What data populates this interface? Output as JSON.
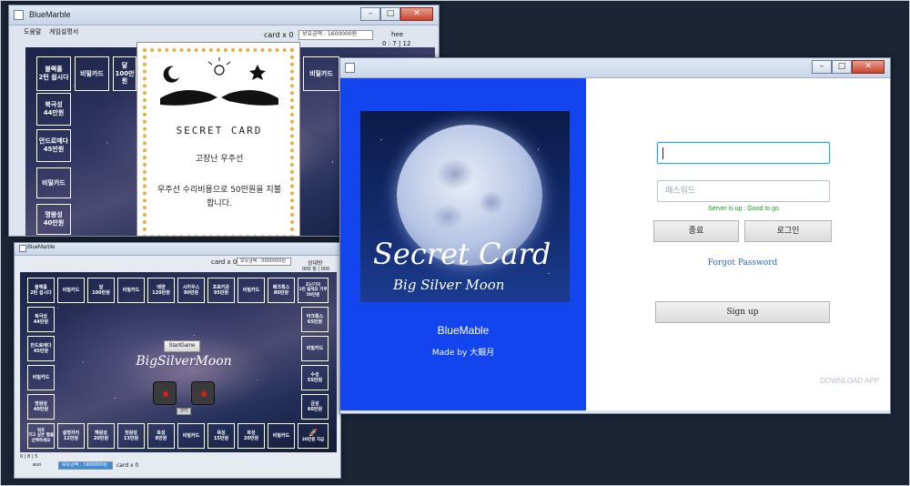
{
  "window_back": {
    "title": "BlueMarble",
    "menu": [
      "도움말",
      "게임설명서"
    ],
    "card_label": "card x 0",
    "money": "보유금액 : 1600000원",
    "user": "hee",
    "turn_info": "0 : 7 | 12",
    "cells": [
      {
        "name": "블랙홀",
        "sub": "2턴 쉽시다"
      },
      {
        "name": "비밀카드",
        "sub": ""
      },
      {
        "name": "달",
        "sub": "100만원"
      },
      {
        "name": "비밀카드",
        "sub": ""
      },
      {
        "name": "북극성",
        "sub": "44만원"
      },
      {
        "name": "안드로메다",
        "sub": "45만원"
      },
      {
        "name": "비밀카드",
        "sub": ""
      },
      {
        "name": "명왕성",
        "sub": "40만원"
      }
    ]
  },
  "secret_card": {
    "heading": "SECRET CARD",
    "subtitle": "고장난 우주선",
    "message": "우주선 수리비용으로 50만원을 지불합니다."
  },
  "window_game": {
    "title": "BlueMarble",
    "card_label": "card x 0",
    "money": "보유금액 : 0000000원",
    "opponent": "상대방",
    "opponent_info": "000 월 | 000",
    "start_button": "StartGame",
    "logo_text": "BigSilverMoon",
    "dice_labels": [
      "",
      ""
    ],
    "roll_label": "굴려",
    "bottom_info": "0 | 8 | 5",
    "bottom_user": "eun",
    "bottom_money": "보유금액 : 1600000원",
    "bottom_card": "card x 0",
    "top_row": [
      {
        "name": "블랙홀",
        "sub": "2턴 쉽시다"
      },
      {
        "name": "비밀카드",
        "sub": ""
      },
      {
        "name": "달",
        "sub": "100만원"
      },
      {
        "name": "비밀카드",
        "sub": ""
      },
      {
        "name": "태양",
        "sub": "120만원"
      },
      {
        "name": "시리우스",
        "sub": "90만원"
      },
      {
        "name": "프로키온",
        "sub": "95만원"
      },
      {
        "name": "비밀카드",
        "sub": ""
      },
      {
        "name": "베크룩스",
        "sub": "80만원"
      },
      {
        "name": "조난기지",
        "sub": "1턴 쉽세요 기부 50만원"
      }
    ],
    "left_col": [
      {
        "name": "북극성",
        "sub": "44만원"
      },
      {
        "name": "안드로메다",
        "sub": "45만원"
      },
      {
        "name": "비밀카드",
        "sub": ""
      },
      {
        "name": "명왕성",
        "sub": "40만원"
      }
    ],
    "right_col": [
      {
        "name": "아크룩스",
        "sub": "65만원"
      },
      {
        "name": "비밀카드",
        "sub": ""
      },
      {
        "name": "수성",
        "sub": "55만원"
      },
      {
        "name": "금성",
        "sub": "60만원"
      }
    ],
    "bottom_row": [
      {
        "name": "워프",
        "sub": "가고 싶은 별을 선택하세요"
      },
      {
        "name": "설명자리",
        "sub": "12만원"
      },
      {
        "name": "해왕성",
        "sub": "20만원"
      },
      {
        "name": "천왕성",
        "sub": "13만원"
      },
      {
        "name": "토성",
        "sub": "8만원"
      },
      {
        "name": "비밀카드",
        "sub": ""
      },
      {
        "name": "목성",
        "sub": "15만원"
      },
      {
        "name": "화성",
        "sub": "20만원"
      },
      {
        "name": "비밀카드",
        "sub": ""
      },
      {
        "name": "출발",
        "sub": "20만원 지급"
      }
    ]
  },
  "window_login": {
    "art_title": "Secret Card",
    "art_subtitle": "Big Silver Moon",
    "app_name": "BlueMable",
    "made_by": "Made by 大銀月",
    "id_placeholder": "",
    "pw_placeholder": "패스워드",
    "server_status": "Server is up : Good to go",
    "exit_button": "종료",
    "login_button": "로그인",
    "forgot": "Forgot Password",
    "signup_button": "Sign up",
    "download": "DOWNLOAD APP"
  },
  "colors": {
    "login_panel": "#1345ef",
    "status_green": "#1aa31a",
    "link_blue": "#2d65c8"
  }
}
